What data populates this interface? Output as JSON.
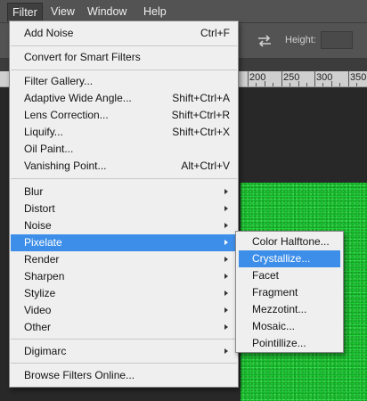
{
  "menubar": {
    "items": [
      "Filter",
      "View",
      "Window",
      "Help"
    ]
  },
  "options_bar": {
    "height_label": "Height:"
  },
  "ruler": {
    "labels": [
      "200",
      "250",
      "300",
      "350"
    ]
  },
  "filter_menu": {
    "add_noise": {
      "label": "Add Noise",
      "shortcut": "Ctrl+F"
    },
    "convert_smart": {
      "label": "Convert for Smart Filters"
    },
    "filter_gallery": {
      "label": "Filter Gallery..."
    },
    "adaptive_wide_angle": {
      "label": "Adaptive Wide Angle...",
      "shortcut": "Shift+Ctrl+A"
    },
    "lens_correction": {
      "label": "Lens Correction...",
      "shortcut": "Shift+Ctrl+R"
    },
    "liquify": {
      "label": "Liquify...",
      "shortcut": "Shift+Ctrl+X"
    },
    "oil_paint": {
      "label": "Oil Paint..."
    },
    "vanishing_point": {
      "label": "Vanishing Point...",
      "shortcut": "Alt+Ctrl+V"
    },
    "blur": {
      "label": "Blur"
    },
    "distort": {
      "label": "Distort"
    },
    "noise": {
      "label": "Noise"
    },
    "pixelate": {
      "label": "Pixelate"
    },
    "render": {
      "label": "Render"
    },
    "sharpen": {
      "label": "Sharpen"
    },
    "stylize": {
      "label": "Stylize"
    },
    "video": {
      "label": "Video"
    },
    "other": {
      "label": "Other"
    },
    "digimarc": {
      "label": "Digimarc"
    },
    "browse_online": {
      "label": "Browse Filters Online..."
    }
  },
  "pixelate_submenu": {
    "items": [
      "Color Halftone...",
      "Crystallize...",
      "Facet",
      "Fragment",
      "Mezzotint...",
      "Mosaic...",
      "Pointillize..."
    ],
    "highlighted": "Crystallize..."
  },
  "colors": {
    "highlight": "#3d8ee9",
    "menu_bg": "#efefef",
    "canvas_green": "#1ed238"
  }
}
